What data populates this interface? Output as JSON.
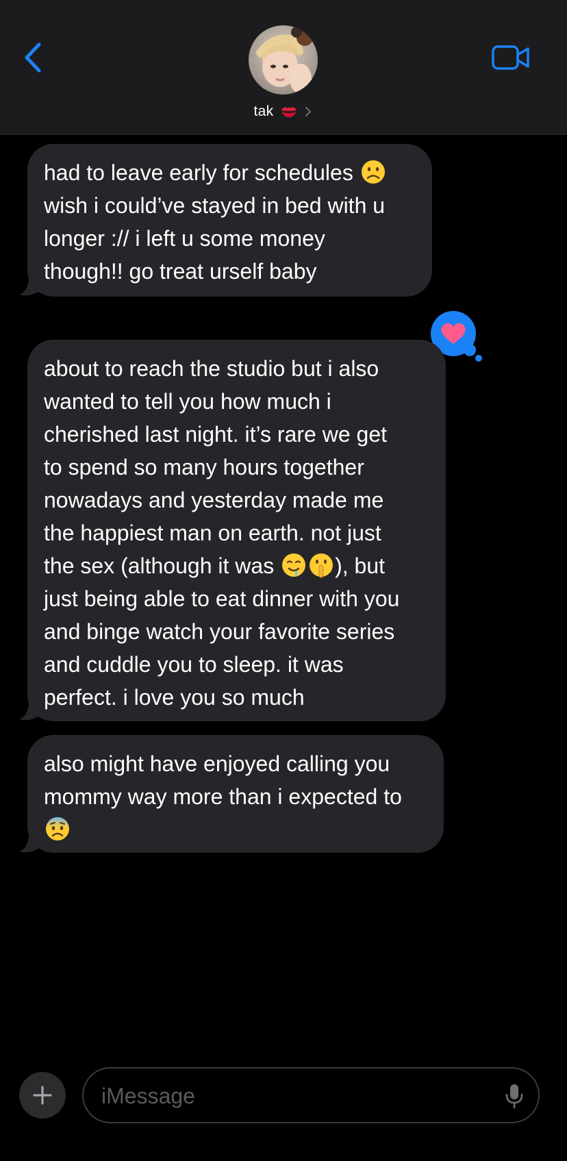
{
  "colors": {
    "accent": "#1b82f5",
    "bubble_incoming": "#26262a",
    "header_bg": "#1c1c1e",
    "tapback_heart": "#ff5b8a"
  },
  "header": {
    "back_icon": "chevron-left-icon",
    "contact_name": "tak",
    "contact_emoji": "💋",
    "video_icon": "video-camera-icon"
  },
  "messages": [
    {
      "sender": "incoming",
      "text": "had to leave early for schedules ☹️ wish i could’ve stayed in bed with u longer :// i left u some money though!! go treat urself baby"
    },
    {
      "sender": "incoming",
      "text": "about to reach the studio but i also wanted to tell you how much i cherished last night. it’s rare we get to spend so many hours together nowadays and yesterday made me the happiest man on earth. not just the sex (although it was 🤤🤫), but just being able to eat dinner with you and binge watch your favorite series and cuddle you to sleep. it was perfect. i love you so much",
      "tapback": "heart"
    },
    {
      "sender": "incoming",
      "text": "also might have enjoyed calling you mommy way more than i expected to 😨"
    }
  ],
  "messages_display": {
    "m1_lines": [
      "had to leave early for schedules ",
      "wish i could’ve stayed in bed with u",
      "longer :// i left u some money",
      "though!! go treat urself baby"
    ],
    "m2_lines": [
      "about to reach the studio but i also",
      "wanted to tell you how much i",
      "cherished last night. it’s rare we get",
      "to spend so many hours together",
      "nowadays and yesterday made me",
      "the happiest man on earth. not just",
      "the sex (although it was ",
      "), but",
      "just being able to eat dinner with you",
      "and binge watch your favorite series",
      "and cuddle you to sleep. it was",
      "perfect. i love you so much"
    ],
    "m3_lines": [
      "also might have enjoyed calling you",
      "mommy way more than i expected to"
    ]
  },
  "input": {
    "placeholder": "iMessage",
    "value": "",
    "plus_icon": "plus-icon",
    "mic_icon": "microphone-icon"
  }
}
